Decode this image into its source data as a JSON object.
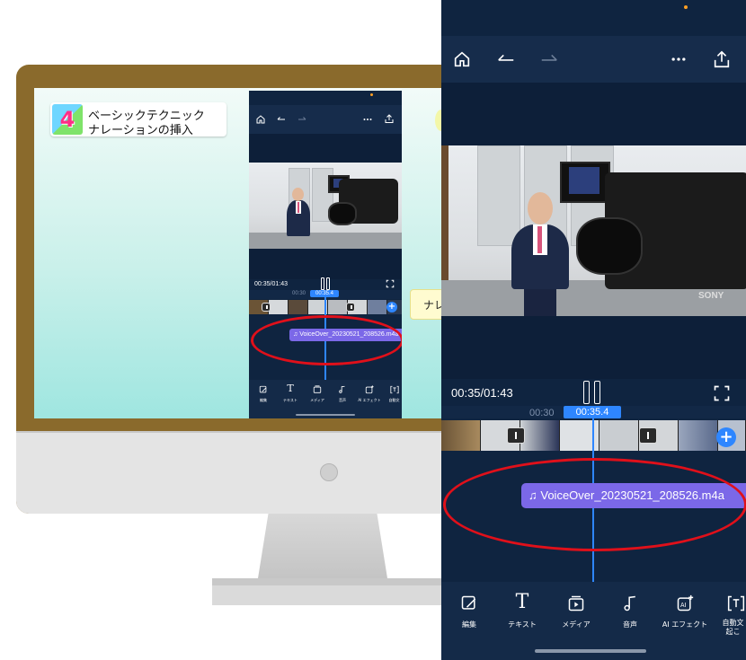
{
  "slide": {
    "step_number": "4",
    "title_line1": "ベーシックテクニック",
    "title_line2": "ナレーションの挿入",
    "side_tag": "ナレ"
  },
  "editor": {
    "current_time": "00:35/01:43",
    "ruler_tick": "00:30",
    "playhead_time": "00:35.4",
    "audio_clip_label": "VoiceOver_20230521_208526.m4a",
    "icons": {
      "home": "home-icon",
      "undo": "undo-icon",
      "redo": "redo-icon",
      "more": "more-icon",
      "export": "export-icon",
      "pause": "pause-icon",
      "fullscreen": "fullscreen-icon",
      "add": "add-clip-icon",
      "music": "music-note-icon"
    },
    "tools": [
      {
        "label": "編集",
        "icon": "edit-icon"
      },
      {
        "label": "テキスト",
        "icon": "text-icon"
      },
      {
        "label": "メディア",
        "icon": "media-icon"
      },
      {
        "label": "音声",
        "icon": "audio-icon"
      },
      {
        "label": "AI エフェクト",
        "icon": "ai-effect-icon"
      },
      {
        "label": "自動文字起こし",
        "label_line1": "自動文",
        "label_line2": "起こ",
        "icon": "auto-caption-icon"
      }
    ],
    "colors": {
      "background": "#0f2440",
      "accent": "#2e86ff",
      "audio_clip": "#7b68e8",
      "highlight_ellipse": "#e0101a"
    }
  }
}
